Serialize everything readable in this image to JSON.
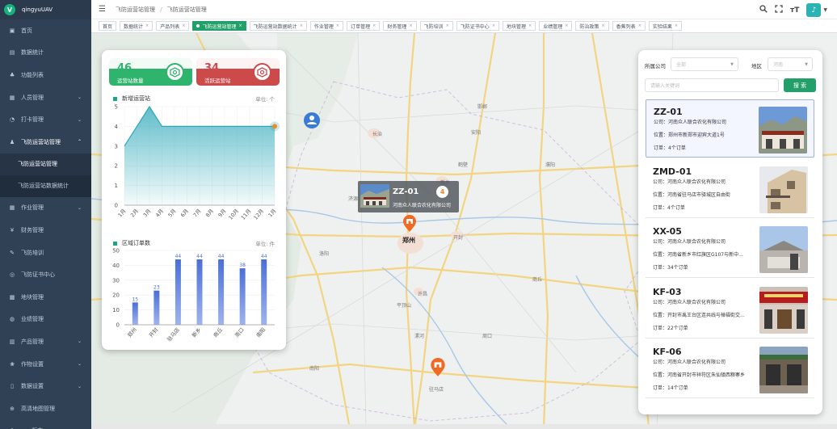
{
  "app": {
    "name": "qingyuUAV",
    "logo_letter": "V"
  },
  "sidebar": {
    "items": [
      {
        "label": "首页",
        "icon": "dashboard-icon"
      },
      {
        "label": "数据统计",
        "icon": "chart-icon"
      },
      {
        "label": "功能列表",
        "icon": "tree-icon"
      },
      {
        "label": "人员管理",
        "icon": "table-icon",
        "arrow": true
      },
      {
        "label": "打卡管理",
        "icon": "clock-icon",
        "arrow": true
      },
      {
        "label": "飞防运营站管理",
        "icon": "user-icon",
        "arrow": true,
        "open": true
      },
      {
        "label": "作业管理",
        "icon": "grid-icon",
        "arrow": true
      },
      {
        "label": "财务管理",
        "icon": "yen-icon"
      },
      {
        "label": "飞防培训",
        "icon": "edu-icon"
      },
      {
        "label": "飞防证书中心",
        "icon": "cert-icon"
      },
      {
        "label": "地块管理",
        "icon": "land-icon"
      },
      {
        "label": "业绩管理",
        "icon": "globe-icon"
      },
      {
        "label": "产品管理",
        "icon": "product-icon",
        "arrow": true
      },
      {
        "label": "作物设置",
        "icon": "crop-icon",
        "arrow": true
      },
      {
        "label": "数据设置",
        "icon": "book-icon",
        "arrow": true
      },
      {
        "label": "高清地图管理",
        "icon": "map-icon"
      },
      {
        "label": "app版本",
        "icon": "app-icon"
      }
    ],
    "sub_items": [
      {
        "label": "飞防运营站管理",
        "active": true
      },
      {
        "label": "飞防运营站数据统计",
        "active": false
      }
    ]
  },
  "header": {
    "breadcrumb": [
      "飞防运营站管理",
      "飞防运营站管理"
    ],
    "avatar_letter": "♪"
  },
  "tags": [
    {
      "label": "首页",
      "close": false
    },
    {
      "label": "数据统计",
      "close": true
    },
    {
      "label": "产品列表",
      "close": true
    },
    {
      "label": "飞防运营站管理",
      "close": true,
      "active": true
    },
    {
      "label": "飞防运营站数据统计",
      "close": true
    },
    {
      "label": "作业管理",
      "close": true
    },
    {
      "label": "订单管理",
      "close": true
    },
    {
      "label": "财务管理",
      "close": true
    },
    {
      "label": "飞防培训",
      "close": true
    },
    {
      "label": "飞防证书中心",
      "close": true
    },
    {
      "label": "地块管理",
      "close": true
    },
    {
      "label": "业绩管理",
      "close": true
    },
    {
      "label": "防治政策",
      "close": true
    },
    {
      "label": "香蕉列表",
      "close": true
    },
    {
      "label": "实验结果",
      "close": true
    }
  ],
  "map": {
    "cities": [
      {
        "name": "长治",
        "x": 348,
        "y": 120
      },
      {
        "name": "济源",
        "x": 318,
        "y": 200
      },
      {
        "name": "焦作",
        "x": 348,
        "y": 206
      },
      {
        "name": "新乡",
        "x": 432,
        "y": 180
      },
      {
        "name": "鹤壁",
        "x": 454,
        "y": 158
      },
      {
        "name": "濮阳",
        "x": 562,
        "y": 158
      },
      {
        "name": "安阳",
        "x": 470,
        "y": 118
      },
      {
        "name": "邯郸",
        "x": 478,
        "y": 86
      },
      {
        "name": "开封",
        "x": 448,
        "y": 248
      },
      {
        "name": "洛阳",
        "x": 282,
        "y": 268
      },
      {
        "name": "平顶山",
        "x": 378,
        "y": 332
      },
      {
        "name": "许昌",
        "x": 404,
        "y": 318
      },
      {
        "name": "漯河",
        "x": 400,
        "y": 370
      },
      {
        "name": "周口",
        "x": 484,
        "y": 370
      },
      {
        "name": "商丘",
        "x": 546,
        "y": 300
      },
      {
        "name": "南阳",
        "x": 270,
        "y": 410
      },
      {
        "name": "驻马店",
        "x": 418,
        "y": 436
      }
    ],
    "city_label_main": "郑州",
    "popup": {
      "code": "ZZ-01",
      "count": "4",
      "company": "河南众人联合农化有限公司"
    }
  },
  "stats": {
    "kpis": [
      {
        "value": "46",
        "label": "运营站数量",
        "color": "#2fb46e"
      },
      {
        "value": "34",
        "label": "活跃运营站",
        "color": "#cc4a4a"
      }
    ],
    "line_title": "新增运营站",
    "line_unit": "单位: 个",
    "bar_title": "区域订单数",
    "bar_unit": "单位: 件"
  },
  "chart_data": [
    {
      "type": "area",
      "title": "新增运营站",
      "categories": [
        "1月",
        "2月",
        "3月",
        "4月",
        "5月",
        "6月",
        "7月",
        "8月",
        "9月",
        "10月",
        "11月",
        "12月",
        "1月"
      ],
      "values": [
        3,
        4,
        5,
        4,
        4,
        4,
        4,
        4,
        4,
        4,
        4,
        4,
        4
      ],
      "ylim": [
        0,
        5
      ],
      "yticks": [
        0,
        1,
        2,
        3,
        4,
        5
      ],
      "color": "#2aa7b8"
    },
    {
      "type": "bar",
      "title": "区域订单数",
      "categories": [
        "郑州",
        "开封",
        "驻马店",
        "新乡",
        "商丘",
        "周口",
        "南阳"
      ],
      "values": [
        15,
        23,
        44,
        44,
        44,
        38,
        44
      ],
      "ylim": [
        0,
        50
      ],
      "yticks": [
        0,
        10,
        20,
        30,
        40,
        50
      ],
      "color": "#4a6fd6"
    }
  ],
  "filters": {
    "company_label": "所属公司",
    "company_value": "全部",
    "region_label": "地区",
    "region_value": "河南",
    "search_placeholder": "请输入关键词",
    "search_button": "搜 索"
  },
  "sites": [
    {
      "code": "ZZ-01",
      "company": "公司：河南众人联合农化有限公司",
      "location": "位置：郑州市新郑市迎宾大道1号",
      "orders": "订单：4个订单"
    },
    {
      "code": "ZMD-01",
      "company": "公司：河南众人联合农化有限公司",
      "location": "位置：河南省驻马店市驿城区自由街",
      "orders": "订单：4个订单"
    },
    {
      "code": "XX-05",
      "company": "公司：河南众人联合农化有限公司",
      "location": "位置：河南省新乡市红旗区G107与新中...",
      "orders": "订单：34个订单"
    },
    {
      "code": "KF-03",
      "company": "公司：河南众人联合农化有限公司",
      "location": "位置：开封市禹王台区连共线与禅福街交...",
      "orders": "订单：22个订单"
    },
    {
      "code": "KF-06",
      "company": "公司：河南众人联合农化有限公司",
      "location": "位置：河南省开封市祥符区朱仙镇西粮寨乡",
      "orders": "订单：14个订单"
    }
  ]
}
